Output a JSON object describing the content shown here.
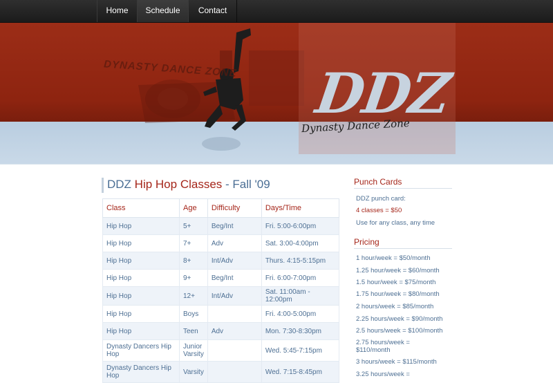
{
  "nav": {
    "items": [
      {
        "label": "Home"
      },
      {
        "label": "Schedule"
      },
      {
        "label": "Contact"
      }
    ]
  },
  "banner": {
    "logo_large": "DDZ",
    "logo_tagline": "Dynasty Dance Zone",
    "background_logo": "DYNASTY DANCE ZONE",
    "colors": {
      "red": "#9c2d17",
      "blue": "#c9d9e8"
    }
  },
  "main": {
    "title_prefix": "DDZ ",
    "title_main": "Hip Hop Classes",
    "title_suffix": " - Fall '09",
    "table": {
      "headers": [
        "Class",
        "Age",
        "Difficulty",
        "Days/Time"
      ],
      "rows": [
        [
          "Hip Hop",
          "5+",
          "Beg/Int",
          "Fri. 5:00-6:00pm"
        ],
        [
          "Hip Hop",
          "7+",
          "Adv",
          "Sat. 3:00-4:00pm"
        ],
        [
          "Hip Hop",
          "8+",
          "Int/Adv",
          "Thurs. 4:15-5:15pm"
        ],
        [
          "Hip Hop",
          "9+",
          "Beg/Int",
          "Fri. 6:00-7:00pm"
        ],
        [
          "Hip Hop",
          "12+",
          "Int/Adv",
          "Sat. 11:00am - 12:00pm"
        ],
        [
          "Hip Hop",
          "Boys",
          "",
          "Fri. 4:00-5:00pm"
        ],
        [
          "Hip Hop",
          "Teen",
          "Adv",
          "Mon. 7:30-8:30pm"
        ],
        [
          "Dynasty Dancers Hip Hop",
          "Junior Varsity",
          "",
          "Wed. 5:45-7:15pm"
        ],
        [
          "Dynasty Dancers Hip Hop",
          "Varsity",
          "",
          "Wed. 7:15-8:45pm"
        ]
      ]
    }
  },
  "sidebar": {
    "punch_heading": "Punch Cards",
    "punch_lines": [
      "DDZ punch card:",
      "4 classes = $50",
      "Use for any class, any time"
    ],
    "pricing_heading": "Pricing",
    "pricing_lines": [
      "1 hour/week = $50/month",
      "1.25 hour/week = $60/month",
      "1.5 hour/week = $75/month",
      "1.75 hour/week = $80/month",
      "2 hours/week = $85/month",
      "2.25 hours/week = $90/month",
      "2.5 hours/week = $100/month",
      "2.75 hours/week = $110/month",
      "3 hours/week = $115/month",
      "3.25 hours/week ="
    ]
  }
}
